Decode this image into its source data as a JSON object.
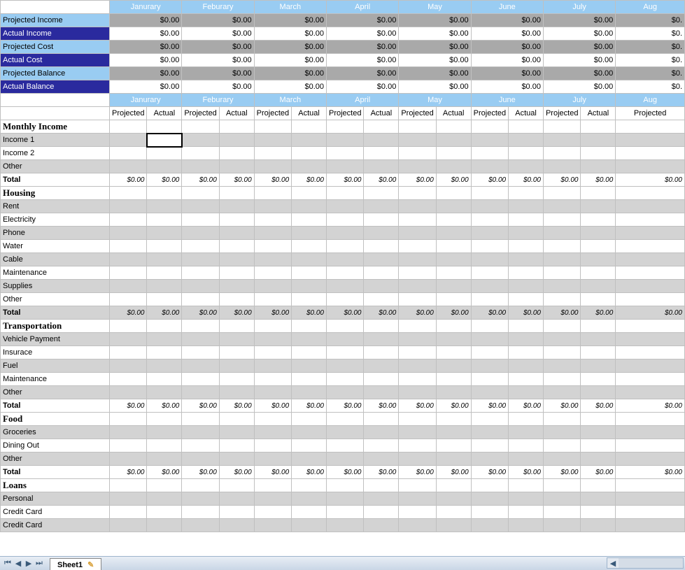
{
  "months": [
    "Janurary",
    "Feburary",
    "March",
    "April",
    "May",
    "June",
    "July",
    "August"
  ],
  "month_partial": "Aug",
  "zero": "$0.00",
  "zero_partial": "$0.",
  "summary_rows": [
    {
      "label": "Projected Income",
      "style": "grey"
    },
    {
      "label": "Actual Income",
      "style": "white"
    },
    {
      "label": "Projected Cost",
      "style": "grey"
    },
    {
      "label": "Actual Cost",
      "style": "white"
    },
    {
      "label": "Projected Balance",
      "style": "grey"
    },
    {
      "label": "Actual Balance",
      "style": "white"
    }
  ],
  "sub_headers": [
    "Projected",
    "Actual"
  ],
  "sections": [
    {
      "title": "Monthly Income",
      "items": [
        "Income 1",
        "Income 2",
        "Other"
      ],
      "total": true
    },
    {
      "title": "Housing",
      "items": [
        "Rent",
        "Electricity",
        "Phone",
        "Water",
        "Cable",
        "Maintenance",
        "Supplies",
        "Other"
      ],
      "total": true
    },
    {
      "title": "Transportation",
      "items": [
        "Vehicle Payment",
        "Insurace",
        "Fuel",
        "Maintenance",
        "Other"
      ],
      "total": true
    },
    {
      "title": "Food",
      "items": [
        "Groceries",
        "Dining Out",
        "Other"
      ],
      "total": true
    },
    {
      "title": "Loans",
      "items": [
        "Personal",
        "Credit Card",
        "Credit Card"
      ],
      "total": false
    }
  ],
  "total_label": "Total",
  "active_cell": {
    "section": 0,
    "item": 0,
    "col": 1
  },
  "sheet_tab": "Sheet1"
}
